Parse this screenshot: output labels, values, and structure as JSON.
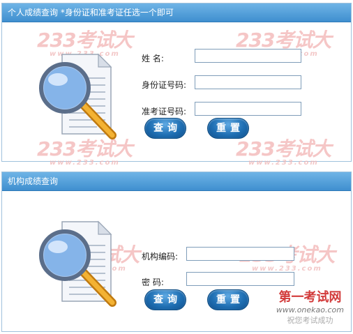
{
  "personal_query": {
    "header": "个人成绩查询 *身份证和准考证任选一个即可",
    "fields": [
      {
        "label": "姓      名:",
        "value": ""
      },
      {
        "label": "身份证号码:",
        "value": ""
      },
      {
        "label": "准考证号码:",
        "value": ""
      }
    ],
    "query_button": "查询",
    "reset_button": "重置"
  },
  "org_query": {
    "header": "机构成绩查询",
    "fields": [
      {
        "label": "机构编码:",
        "value": ""
      },
      {
        "label": "密      码:",
        "value": ""
      }
    ],
    "query_button": "查询",
    "reset_button": "重置"
  },
  "watermarks": {
    "brand": "233考试大",
    "url": "www.233.com",
    "footer_title": "第一考试网",
    "footer_url": "www.onekao.com",
    "footer_slogan": "祝您考试成功"
  },
  "icons": {
    "search_document": "document-magnifier-icon"
  },
  "colors": {
    "header": "#4a9ad6",
    "button": "#1f6fb3",
    "watermark": "#f2b3b3"
  }
}
